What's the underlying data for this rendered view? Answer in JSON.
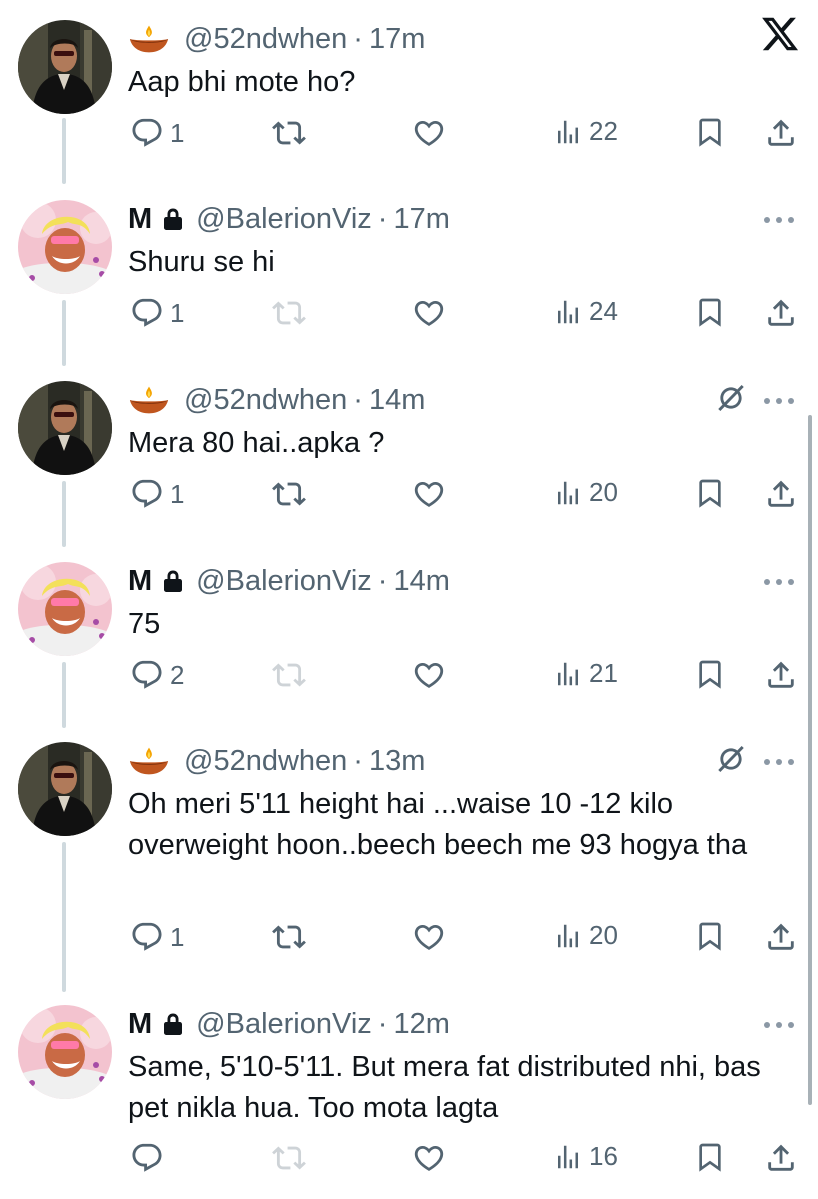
{
  "close_button": {
    "icon": "x-logo-close-icon"
  },
  "colors": {
    "text": "#0f1419",
    "secondary": "#536471",
    "thread_line": "#cfd9de",
    "background": "#ffffff"
  },
  "tweets": [
    {
      "display_name": "",
      "handle": "@52ndwhen",
      "separator": "·",
      "time": "17m",
      "text": "Aap bhi mote ho?",
      "replies": "1",
      "reposts": "",
      "views": "22",
      "author_icon": "diya-lamp-icon"
    },
    {
      "display_name": "M",
      "handle": "@BalerionViz",
      "separator": "·",
      "time": "17m",
      "text": "Shuru se hi",
      "replies": "1",
      "reposts": "",
      "views": "24",
      "author_icon": "lock-icon"
    },
    {
      "display_name": "",
      "handle": "@52ndwhen",
      "separator": "·",
      "time": "14m",
      "text": "Mera 80 hai..apka ?",
      "replies": "1",
      "reposts": "",
      "views": "20",
      "author_icon": "diya-lamp-icon"
    },
    {
      "display_name": "M",
      "handle": "@BalerionViz",
      "separator": "·",
      "time": "14m",
      "text": "75",
      "replies": "2",
      "reposts": "",
      "views": "21",
      "author_icon": "lock-icon"
    },
    {
      "display_name": "",
      "handle": "@52ndwhen",
      "separator": "·",
      "time": "13m",
      "text": "Oh meri 5'11 height hai ...waise 10 -12 kilo overweight hoon..beech beech me 93 hogya tha",
      "replies": "1",
      "reposts": "",
      "views": "20",
      "author_icon": "diya-lamp-icon"
    },
    {
      "display_name": "M",
      "handle": "@BalerionViz",
      "separator": "·",
      "time": "12m",
      "text": "Same, 5'10-5'11. But mera fat distributed nhi, bas pet nikla hua. Too mota lagta",
      "replies": "",
      "reposts": "",
      "views": "16",
      "author_icon": "lock-icon"
    }
  ]
}
